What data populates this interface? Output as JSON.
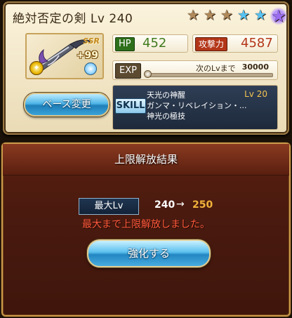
{
  "weapon": {
    "title": "絶対否定の剣 Lv 240",
    "rarity_badge": "SSR",
    "plus": "+99",
    "stars": [
      "bronze",
      "bronze",
      "bronze",
      "blue",
      "blue",
      "purple"
    ],
    "element_icon": "light-element-icon",
    "skill_type_icon": "skill-type-icon"
  },
  "stats": {
    "hp_label": "HP",
    "hp_value": "452",
    "atk_label": "攻撃力",
    "atk_value": "4587",
    "exp_label": "EXP",
    "exp_next_label": "次のLvまで",
    "exp_next_value": "30000",
    "exp_progress": 0
  },
  "buttons": {
    "base_change": "ベース変更",
    "upgrade": "強化する"
  },
  "skill": {
    "label": "SKILL",
    "name": "天光の神醒",
    "level": "Lv 20",
    "desc_line1": "ガンマ・リベレイション・...",
    "desc_line2": "神光の極技"
  },
  "result": {
    "title": "上限解放結果",
    "max_lv_label": "最大Lv",
    "lv_from": "240",
    "arrow": "→",
    "lv_to": "250",
    "message": "最大まで上限解放しました。"
  },
  "colors": {
    "hp": "#3f7a1d",
    "atk": "#b33618",
    "highlight": "#f0b23a",
    "message": "#ff5a3c"
  }
}
